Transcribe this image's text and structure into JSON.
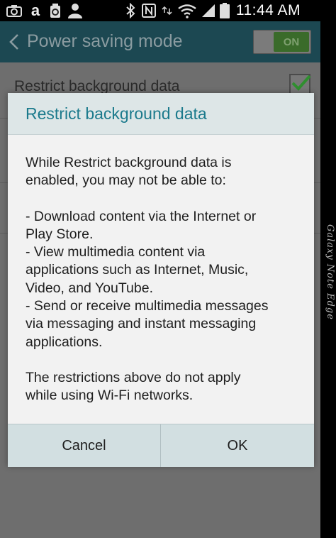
{
  "status_bar": {
    "time": "11:44 AM",
    "left_icons": [
      "camera-icon",
      "amazon-icon",
      "recycle-icon",
      "person-icon"
    ],
    "right_icons": [
      "bluetooth-icon",
      "nfc-icon",
      "wifi-icon",
      "signal-icon",
      "battery-icon"
    ]
  },
  "action_bar": {
    "title": "Power saving mode",
    "switch_label": "ON"
  },
  "list": {
    "items": [
      {
        "label": "Restrict background data",
        "checked": true
      }
    ]
  },
  "dialog": {
    "title": "Restrict background data",
    "body": [
      "While Restrict background data is",
      "enabled, you may not be able to:",
      "",
      "- Download content via the Internet or",
      "Play Store.",
      "- View multimedia content via",
      "applications such as Internet, Music,",
      "Video, and YouTube.",
      "- Send or receive multimedia messages",
      "via messaging and instant messaging",
      "applications.",
      "",
      "The restrictions above do not apply",
      "while using Wi-Fi networks."
    ],
    "cancel_label": "Cancel",
    "ok_label": "OK"
  },
  "bezel": {
    "brand": "Galaxy Note Edge"
  },
  "colors": {
    "action_bar": "#1c4852",
    "dialog_title": "#1b7a8c",
    "check_green": "#2f8f2f",
    "switch_on": "#3a6b2a"
  }
}
